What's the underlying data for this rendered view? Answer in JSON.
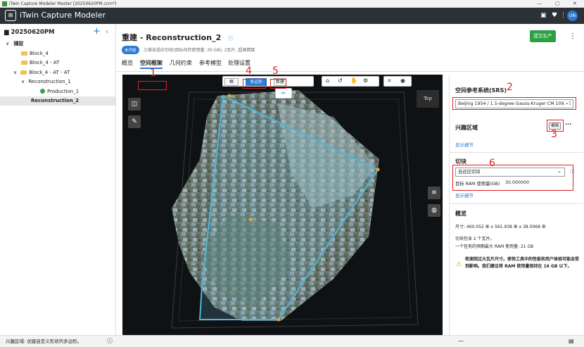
{
  "window": {
    "title": "iTwin Capture Modeler Master [20250620PM.ccm*]",
    "min": "—",
    "max": "▢",
    "close": "✕"
  },
  "appbar": {
    "app_name": "iTwin Capture Modeler",
    "avatar": "UN",
    "monitor_icon": "monitor-icon",
    "bulb_icon": "lightbulb-icon",
    "help_icon": "help-icon"
  },
  "sidebar": {
    "project": "20250620PM",
    "add": "+",
    "collapse": "‹",
    "items": [
      {
        "label": "捕捉",
        "chev": "∨"
      },
      {
        "label": "Block_4"
      },
      {
        "label": "Block_4 - AT"
      },
      {
        "label": "Block_4 - AT - AT",
        "chev": "∨"
      },
      {
        "label": "Reconstruction_1",
        "chev": "∨"
      },
      {
        "label": "Production_1"
      },
      {
        "label": "Reconstruction_2"
      }
    ]
  },
  "header": {
    "title": "重建 - Reconstruction_2",
    "badge": "未开始",
    "subtext": "三维自适应切块(目标内存使用量: 30 GB), 2瓦片, 超高精度",
    "submit": "提交生产",
    "more": "⋮",
    "tabs": [
      "概览",
      "空间框架",
      "几何约束",
      "参考模型",
      "处理设置"
    ]
  },
  "viewport": {
    "seg_box": "框",
    "seg_polygon": "多边形",
    "new_btn": "新建",
    "top_label": "Top"
  },
  "annotations": [
    "1",
    "2",
    "3",
    "4",
    "5",
    "6"
  ],
  "panel": {
    "srs_title": "空间参考系统(SRS)",
    "srs_value": "Beijing 1954 / 1.5-degree Gauss-Kruger CM 109.5E",
    "roi_title": "兴趣区域",
    "edit_btn": "编辑",
    "roi_more": "···",
    "roi_link": "显示细节",
    "tile_title": "切块",
    "tile_value": "自适应切块",
    "ram_label": "目标 RAM 使用量(GB)",
    "ram_value": "30.000000",
    "tile_link": "显示细节",
    "overview_title": "概览",
    "size": "尺寸: 460.052 米 x 561.938 米 x 38.0068 米",
    "tiles_line": "切块包含 2 个瓦片。",
    "ram_line": "一个任务的预期最大 RAM 使用量: 21 GB",
    "warning": "检测到过大瓦片尺寸。修饰工具中的性能和用户体验可能会受到影响。我们建议将 RAM 使用量保持在 16 GB 以下。"
  },
  "statusbar": {
    "text": "兴趣区域: 创建自定义形状的多边形。",
    "info_icon": "ⓘ"
  }
}
